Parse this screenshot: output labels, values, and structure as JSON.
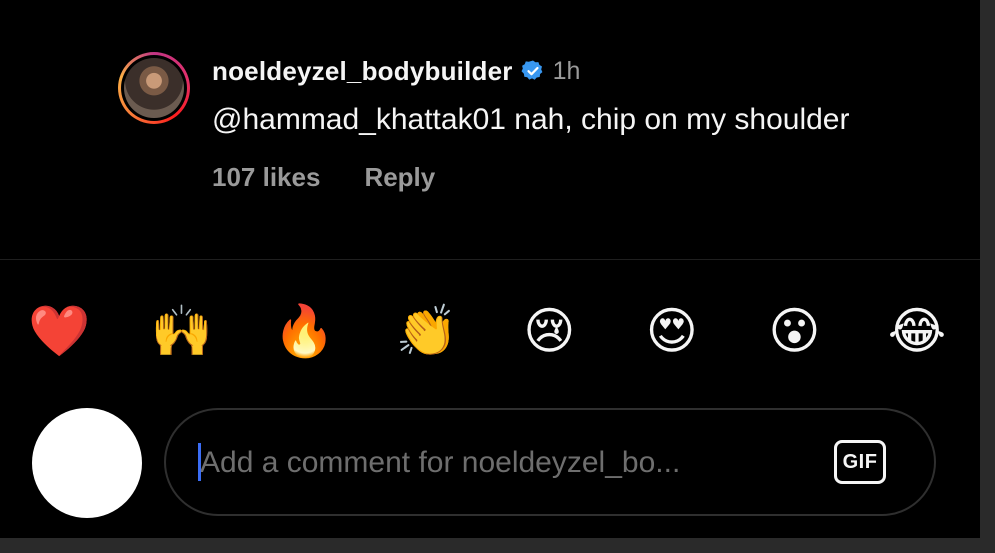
{
  "comment": {
    "username": "noeldeyzel_bodybuilder",
    "verified_icon": "verified-badge-icon",
    "time": "1h",
    "text": "@hammad_khattak01 nah, chip on my shoulder",
    "likes": "107 likes",
    "reply_label": "Reply",
    "like_icon": "heart-outline-icon"
  },
  "reactions": [
    {
      "emoji": "❤️",
      "name": "red-heart"
    },
    {
      "emoji": "🙌",
      "name": "raising-hands"
    },
    {
      "emoji": "🔥",
      "name": "fire"
    },
    {
      "emoji": "👏",
      "name": "clapping-hands"
    },
    {
      "emoji": "😢",
      "name": "crying-face"
    },
    {
      "emoji": "😍",
      "name": "heart-eyes"
    },
    {
      "emoji": "😮",
      "name": "surprised-face"
    },
    {
      "emoji": "😂",
      "name": "tears-of-joy"
    }
  ],
  "composer": {
    "placeholder": "Add a comment for noeldeyzel_bo...",
    "gif_label": "GIF"
  },
  "colors": {
    "background": "#000000",
    "text_primary": "#f5f5f5",
    "text_secondary": "#9a9a9a",
    "verified_blue": "#3897f0",
    "caret_blue": "#3b6df5"
  }
}
